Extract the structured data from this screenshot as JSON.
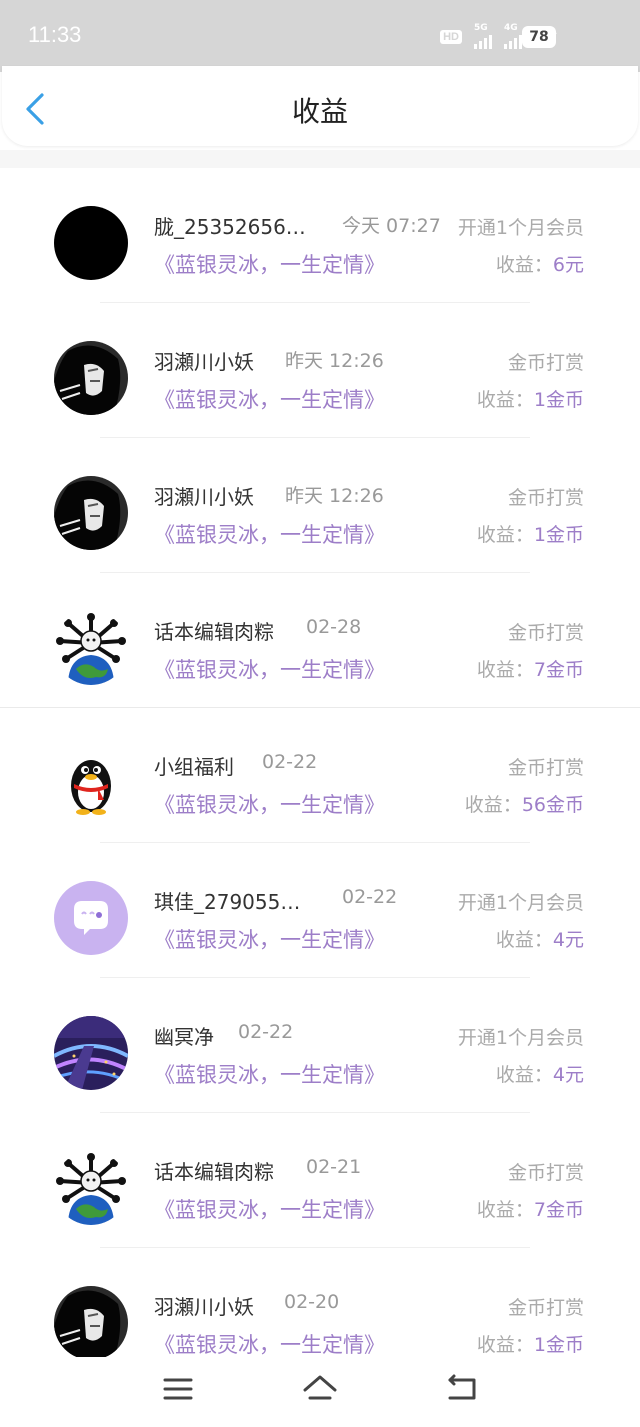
{
  "status_bar": {
    "time": "11:33",
    "hd": "HD",
    "net1": "5G",
    "net2": "4G",
    "battery": "78"
  },
  "header": {
    "title": "收益"
  },
  "earn_label": "收益：",
  "records": [
    {
      "name": "胧_25352656…",
      "date": "今天 07:27",
      "type": "开通1个月会员",
      "book": "《蓝银灵冰，一生定情》",
      "earnings": "6元",
      "avatar": "black-circle"
    },
    {
      "name": "羽瀬川小妖",
      "date": "昨天 12:26",
      "type": "金币打赏",
      "book": "《蓝银灵冰，一生定情》",
      "earnings": "1金币",
      "avatar": "hooded-figure"
    },
    {
      "name": "羽瀬川小妖",
      "date": "昨天 12:26",
      "type": "金币打赏",
      "book": "《蓝银灵冰，一生定情》",
      "earnings": "1金币",
      "avatar": "hooded-figure"
    },
    {
      "name": "话本编辑肉粽",
      "date": "02-28",
      "type": "金币打赏",
      "book": "《蓝银灵冰，一生定情》",
      "earnings": "7金币",
      "avatar": "virus-globe"
    },
    {
      "name": "小组福利",
      "date": "02-22",
      "type": "金币打赏",
      "book": "《蓝银灵冰，一生定情》",
      "earnings": "56金币",
      "avatar": "penguin"
    },
    {
      "name": "琪佳_279055…",
      "date": "02-22",
      "type": "开通1个月会员",
      "book": "《蓝银灵冰，一生定情》",
      "earnings": "4元",
      "avatar": "purple-chat-bubble"
    },
    {
      "name": "幽冥净",
      "date": "02-22",
      "type": "开通1个月会员",
      "book": "《蓝银灵冰，一生定情》",
      "earnings": "4元",
      "avatar": "night-highway"
    },
    {
      "name": "话本编辑肉粽",
      "date": "02-21",
      "type": "金币打赏",
      "book": "《蓝银灵冰，一生定情》",
      "earnings": "7金币",
      "avatar": "virus-globe"
    },
    {
      "name": "羽瀬川小妖",
      "date": "02-20",
      "type": "金币打赏",
      "book": "《蓝银灵冰，一生定情》",
      "earnings": "1金币",
      "avatar": "hooded-figure"
    }
  ],
  "colors": {
    "accent": "#9d7ec8",
    "back_arrow": "#3aa0e6",
    "muted": "#aaaaaa",
    "status_bar": "#d6d6d6"
  },
  "nav_bar": {
    "icons": [
      "menu-icon",
      "home-icon",
      "back-icon"
    ]
  }
}
